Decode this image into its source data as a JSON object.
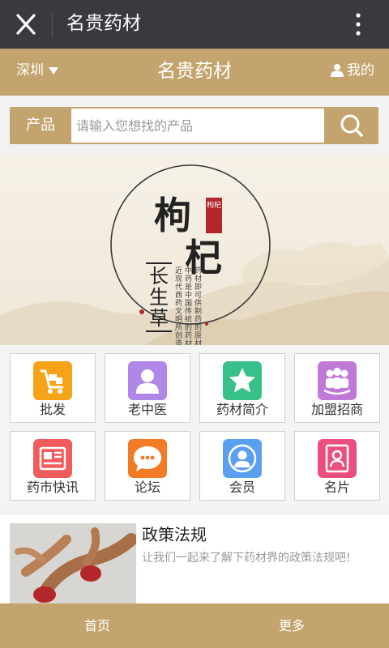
{
  "wechat": {
    "title": "名贵药材"
  },
  "header": {
    "city": "深圳",
    "title": "名贵药材",
    "me": "我的"
  },
  "search": {
    "category": "产品",
    "placeholder": "请输入您想找的产品"
  },
  "banner": {
    "title_chars": [
      "枸",
      "杞"
    ],
    "seal": "枸杞",
    "subtitle_chars": [
      "长",
      "生",
      "草"
    ],
    "verse_cols": [
      "药材即可供制药的原材",
      "中药是中国传统的药材",
      "近现代西药文明所创造"
    ]
  },
  "categories": [
    {
      "label": "批发",
      "icon": "cart-icon",
      "color": "#f6a31a"
    },
    {
      "label": "老中医",
      "icon": "doctor-icon",
      "color": "#b086e6"
    },
    {
      "label": "药材简介",
      "icon": "star-icon",
      "color": "#37c08a"
    },
    {
      "label": "加盟招商",
      "icon": "group-icon",
      "color": "#c079d6"
    },
    {
      "label": "药市快讯",
      "icon": "news-icon",
      "color": "#f05b5b"
    },
    {
      "label": "论坛",
      "icon": "chat-icon",
      "color": "#f47b26"
    },
    {
      "label": "会员",
      "icon": "member-icon",
      "color": "#5b9ff0"
    },
    {
      "label": "名片",
      "icon": "card-icon",
      "color": "#ec4f7f"
    }
  ],
  "news": {
    "title": "政策法规",
    "desc": "让我们一起来了解下药材界的政策法规吧!"
  },
  "bottom": {
    "home": "首页",
    "more": "更多"
  },
  "colors": {
    "accent": "#c4a46e",
    "topbar": "#393a3f"
  }
}
